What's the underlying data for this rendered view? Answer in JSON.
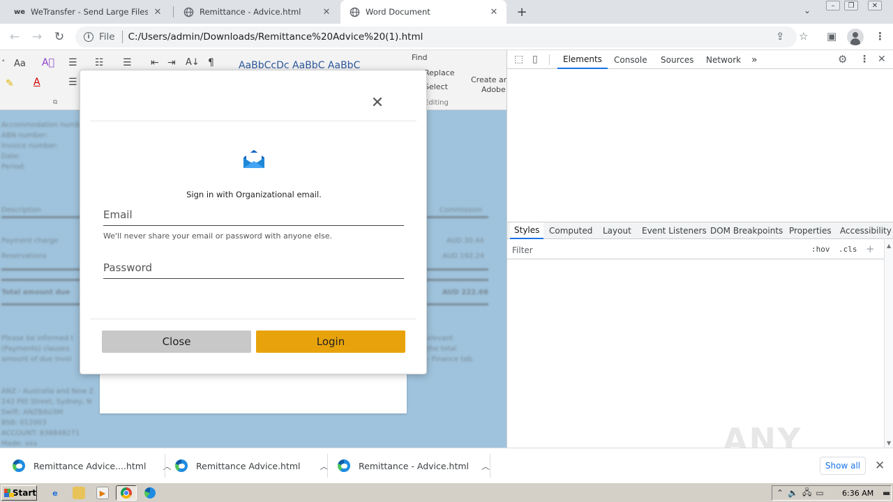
{
  "browser": {
    "tabs": [
      {
        "title": "WeTransfer - Send Large Files & Shar",
        "favicon": "wetransfer-logo",
        "favicon_text": "we",
        "active": false
      },
      {
        "title": "Remittance - Advice.html",
        "favicon": "globe-icon",
        "active": false
      },
      {
        "title": "Word Document",
        "favicon": "globe-icon",
        "active": true
      }
    ],
    "address": {
      "scheme_label": "File",
      "url": "C:/Users/admin/Downloads/Remittance%20Advice%20(1).html"
    }
  },
  "ribbon": {
    "font_group": "Aa",
    "styles_preview": "AaBbCcDc AaBbC AaBbC",
    "find": "Find",
    "replace": "Replace",
    "select": "Select",
    "editing": "Editing",
    "create_share": "Create and",
    "adobe": "Adobe"
  },
  "document": {
    "meta_lines": [
      "Accommodation number:",
      "ABN number:",
      "Invoice number:",
      "Date:",
      "Period:"
    ],
    "col_description": "Description",
    "col_commission": "Commission",
    "rows": [
      {
        "label": "Payment charge",
        "value": "AUD 30.44"
      },
      {
        "label": "Reservations",
        "value": "AUD 192.24"
      }
    ],
    "total_label": "Total amount due",
    "total_value": "AUD 222.68",
    "notice_lines": [
      "Please be informed t",
      "(Payments) clauses.",
      "amount of due invoi"
    ],
    "notice_right": [
      "elevant",
      "the total",
      "- Finance tab."
    ],
    "bank_lines": [
      "ANZ - Australia and New Z",
      "242 Pitt Street, Sydney, N",
      "Swift: ANZBAU3M",
      "BSB: 012003",
      "ACCOUNT: 836848271",
      "Made: xxx"
    ]
  },
  "modal": {
    "heading": "Sign in with Organizational email.",
    "email_placeholder": "Email",
    "email_help": "We'll never share your email or password with anyone else.",
    "password_placeholder": "Password",
    "close_label": "Close",
    "login_label": "Login",
    "colors": {
      "login": "#e8a30c",
      "close": "#c8c8c8",
      "envelope": "#1e88d6"
    }
  },
  "devtools": {
    "tabs": [
      "Elements",
      "Console",
      "Sources",
      "Network"
    ],
    "active_tab": "Elements",
    "more": "»",
    "subtabs": [
      "Styles",
      "Computed",
      "Layout",
      "Event Listeners",
      "DOM Breakpoints",
      "Properties",
      "Accessibility"
    ],
    "active_subtab": "Styles",
    "filter_placeholder": "Filter",
    "hov": ":hov",
    "cls": ".cls",
    "add": "+"
  },
  "downloads": {
    "items": [
      "Remittance Advice....html",
      "Remittance Advice.html",
      "Remittance - Advice.html"
    ],
    "show_all": "Show all"
  },
  "taskbar": {
    "start_label": "Start",
    "clock": "6:36 AM"
  },
  "watermark": "ANY RUN"
}
